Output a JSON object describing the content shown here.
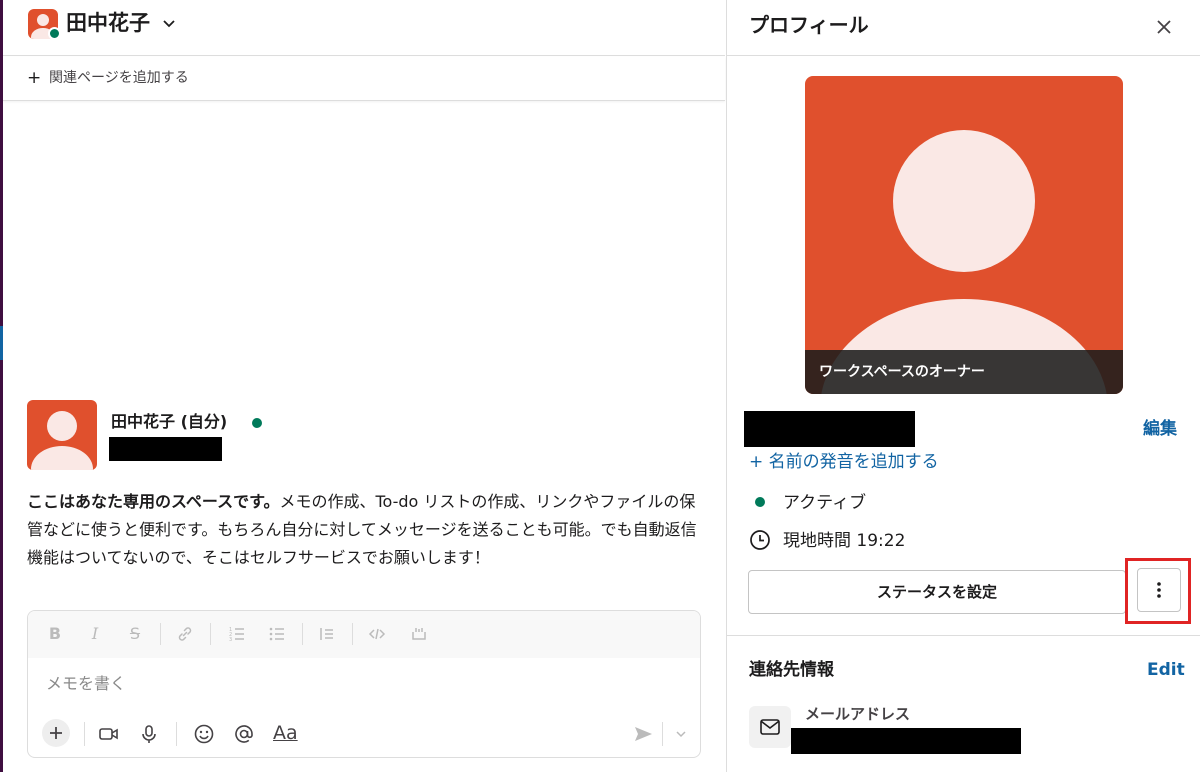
{
  "channel": {
    "title": "田中花子",
    "bookmark_label": "関連ページを追加する"
  },
  "intro": {
    "name": "田中花子 (自分)",
    "text_bold": "ここはあなた専用のスペースです。",
    "text_rest": "メモの作成、To-do リストの作成、リンクやファイルの保管などに使うと便利です。もちろん自分に対してメッセージを送ることも可能。でも自動返信機能はついてないので、そこはセルフサービスでお願いします！"
  },
  "composer": {
    "placeholder": "メモを書く",
    "format_label": "Aa"
  },
  "profile": {
    "title": "プロフィール",
    "owner_label": "ワークスペースのオーナー",
    "edit_label": "編集",
    "pronunciation_link": "+ 名前の発音を追加する",
    "status": "アクティブ",
    "local_time": "現地時間 19:22",
    "set_status_button": "ステータスを設定",
    "contact_title": "連絡先情報",
    "contact_edit": "Edit",
    "email_label": "メールアドレス"
  },
  "colors": {
    "avatar_bg": "#e0502d",
    "presence": "#007a5a",
    "link": "#1264a3",
    "highlight": "#e02424"
  }
}
